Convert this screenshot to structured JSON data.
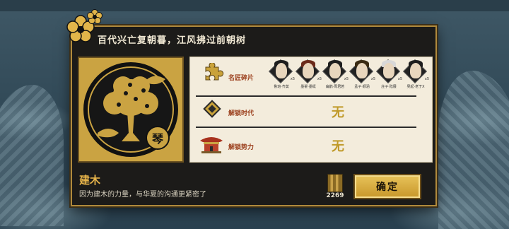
{
  "dialog": {
    "title": "百代兴亡复朝暮，江风拂过前朝树"
  },
  "emblem": {
    "seal_char": "琴"
  },
  "rows": [
    {
      "label": "名匠碎片",
      "icon": "puzzle-piece-icon"
    },
    {
      "label": "解锁时代",
      "icon": "diamond-era-icon",
      "value": "无"
    },
    {
      "label": "解锁势力",
      "icon": "palace-icon",
      "value": "无"
    }
  ],
  "portraits": [
    {
      "name": "鲁班·齐莫",
      "count": "x5"
    },
    {
      "name": "墨翟·墨蜓",
      "count": "x5"
    },
    {
      "name": "扁鹊·周君若",
      "count": "x5"
    },
    {
      "name": "孟子·顺涵",
      "count": "x5"
    },
    {
      "name": "庄子·陆展",
      "count": "x5"
    },
    {
      "name": "吴起·老于X",
      "count": "x5"
    }
  ],
  "item": {
    "name": "建木",
    "description": "因为建木的力量，与华夏的沟通更紧密了"
  },
  "cost": {
    "value": "2269",
    "icon": "bamboo-scroll-icon"
  },
  "confirm_label": "确定",
  "colors": {
    "accent_gold": "#c8962a",
    "panel_dark": "#1c1b19",
    "label_red": "#9a3d1a"
  }
}
